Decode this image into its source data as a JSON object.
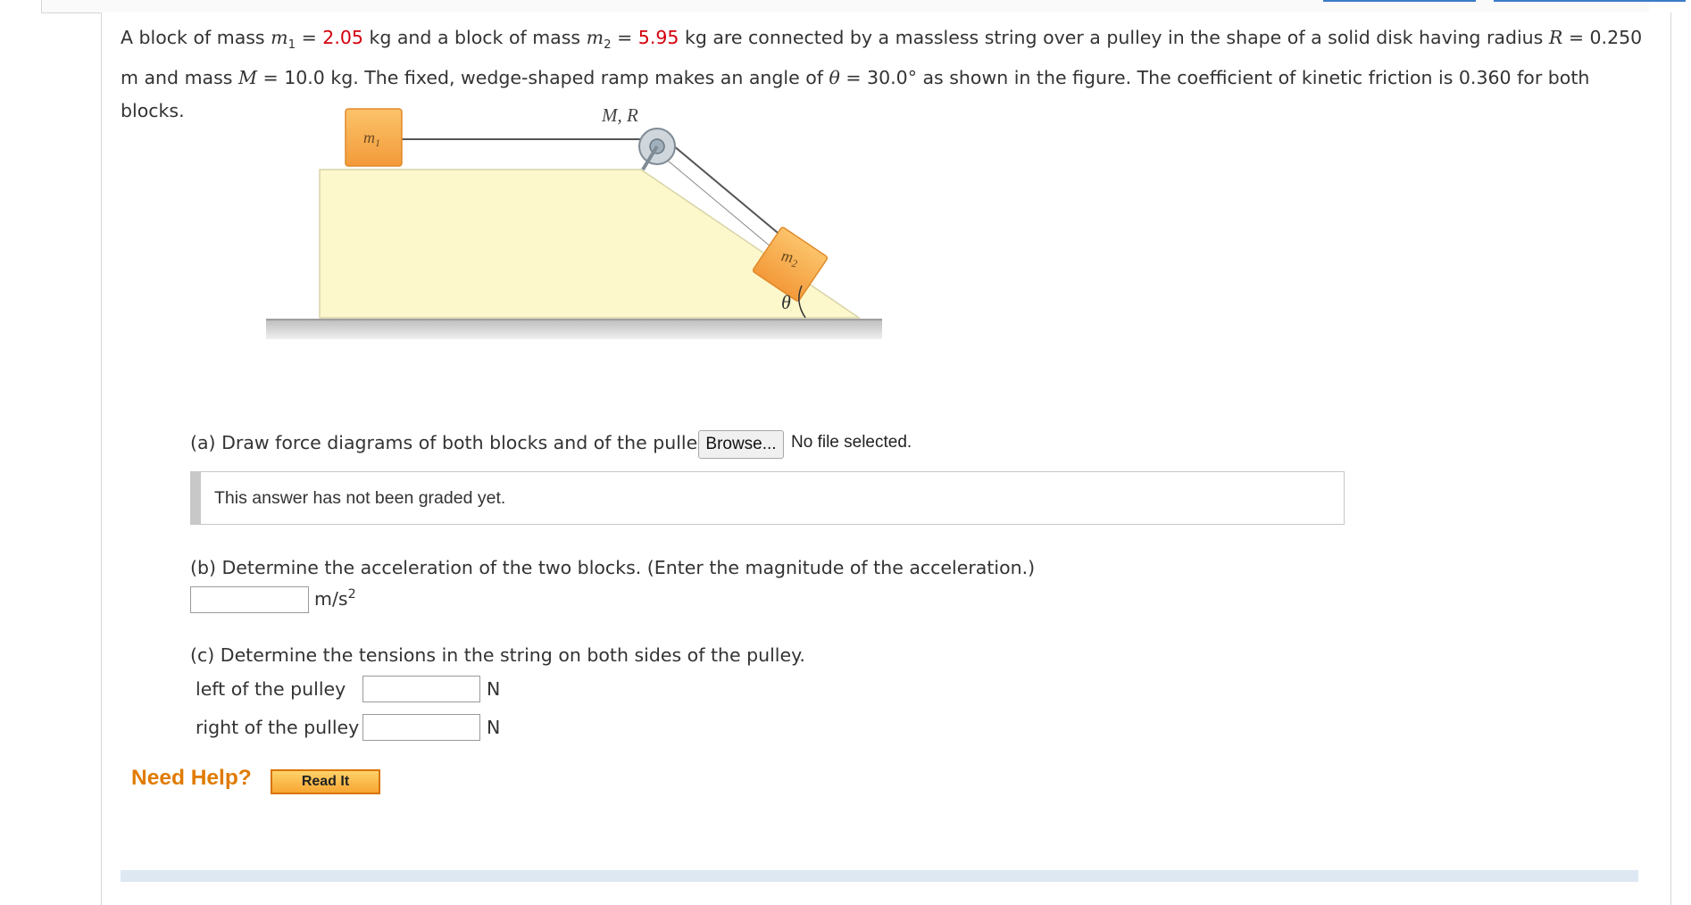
{
  "question": {
    "t1": "A block of mass ",
    "m1_var": "m",
    "m1_sub": "1",
    "eq1": " = ",
    "m1_value": "2.05",
    "t2": " kg and a block of mass ",
    "m2_var": "m",
    "m2_sub": "2",
    "eq2": " = ",
    "m2_value": "5.95",
    "t3": " kg are connected by a massless string over a pulley in the shape of a solid disk having radius ",
    "r_var": "R",
    "t4": " = 0.250 m and mass ",
    "m_var": "M",
    "t5": " = 10.0 kg. The fixed, wedge-shaped ramp makes an angle of ",
    "theta_var": "θ",
    "t6": " = 30.0° as shown in the figure. The coefficient of kinetic friction is 0.360 for both blocks."
  },
  "figure": {
    "pulley_label": "M, R",
    "block1_label": "m",
    "block1_sub": "1",
    "block2_label": "m",
    "block2_sub": "2",
    "angle_label": "θ"
  },
  "part_a": {
    "prompt": "(a) Draw force diagrams of both blocks and of the pulley.",
    "browse_label": "Browse...",
    "file_status": "No file selected.",
    "graded_message": "This answer has not been graded yet."
  },
  "part_b": {
    "prompt": "(b) Determine the acceleration of the two blocks. (Enter the magnitude of the acceleration.)",
    "input_value": "",
    "unit_base": "m/s",
    "unit_exp": "2"
  },
  "part_c": {
    "prompt": "(c) Determine the tensions in the string on both sides of the pulley.",
    "left_label": "left of the pulley",
    "left_value": "",
    "left_unit": "N",
    "right_label": "right of the pulley",
    "right_value": "",
    "right_unit": "N"
  },
  "help": {
    "need_help_label": "Need Help?",
    "read_it_label": "Read It"
  },
  "colors": {
    "given_value": "#d4000d",
    "ramp_fill": "#fdf8cc",
    "block_fill": "#f7a94a",
    "need_help": "#e07b00"
  }
}
